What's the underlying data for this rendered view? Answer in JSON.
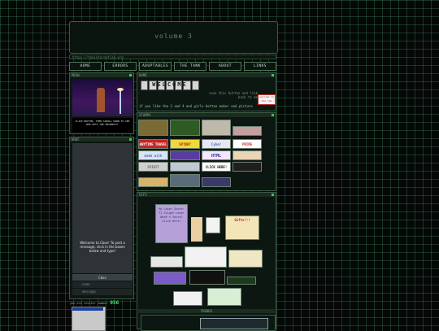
{
  "banner": {
    "title": "volume 3"
  },
  "url": "https://theinternetlab.org",
  "nav": [
    "HOME",
    "ERRORS",
    "ADOPTABLES",
    "THE TANK",
    "ABOUT",
    "LINKS"
  ],
  "sidebar": {
    "card_head": "MEOW",
    "card_caption": "CLICK BUTTON, THEN SCROLL DOWN TO SEE WHO GETS THE HEADBUTT!",
    "woof_head": "WOOF",
    "chat_welcome": "Welcome to Cbox! To post a message, click in the boxes below and type!",
    "chat_name_label": "Cbox",
    "chat_name_placeholder": "name",
    "chat_message_placeholder": "message",
    "visitor_label": "you are visitor number",
    "visitor_count": "056"
  },
  "main": {
    "home_head": "HOME",
    "welcome_word": "WELCOME",
    "save_text": "save this button and link back to me",
    "right_button": "welcome to the lab",
    "announcement": "if you like the 3 and 4 and girls button maker and picture",
    "stamps_head": "STAMPS",
    "stamps": [
      "",
      "",
      "",
      "",
      "ANYTIME TRAVEL",
      "SPIDEY",
      "Cyber",
      "PRIDE",
      "made with",
      "",
      "HTML",
      "",
      "SPIRIT",
      "",
      "CLICK HERE!",
      "",
      "",
      "",
      "",
      "",
      ""
    ],
    "gifs_head": "GIFS",
    "gifs": {
      "loser_score": "My Loser Score: 71 Slight Loser What's Yours? Click Here!",
      "gifts": "Gifts!!!"
    },
    "things_head": "THINGS"
  }
}
